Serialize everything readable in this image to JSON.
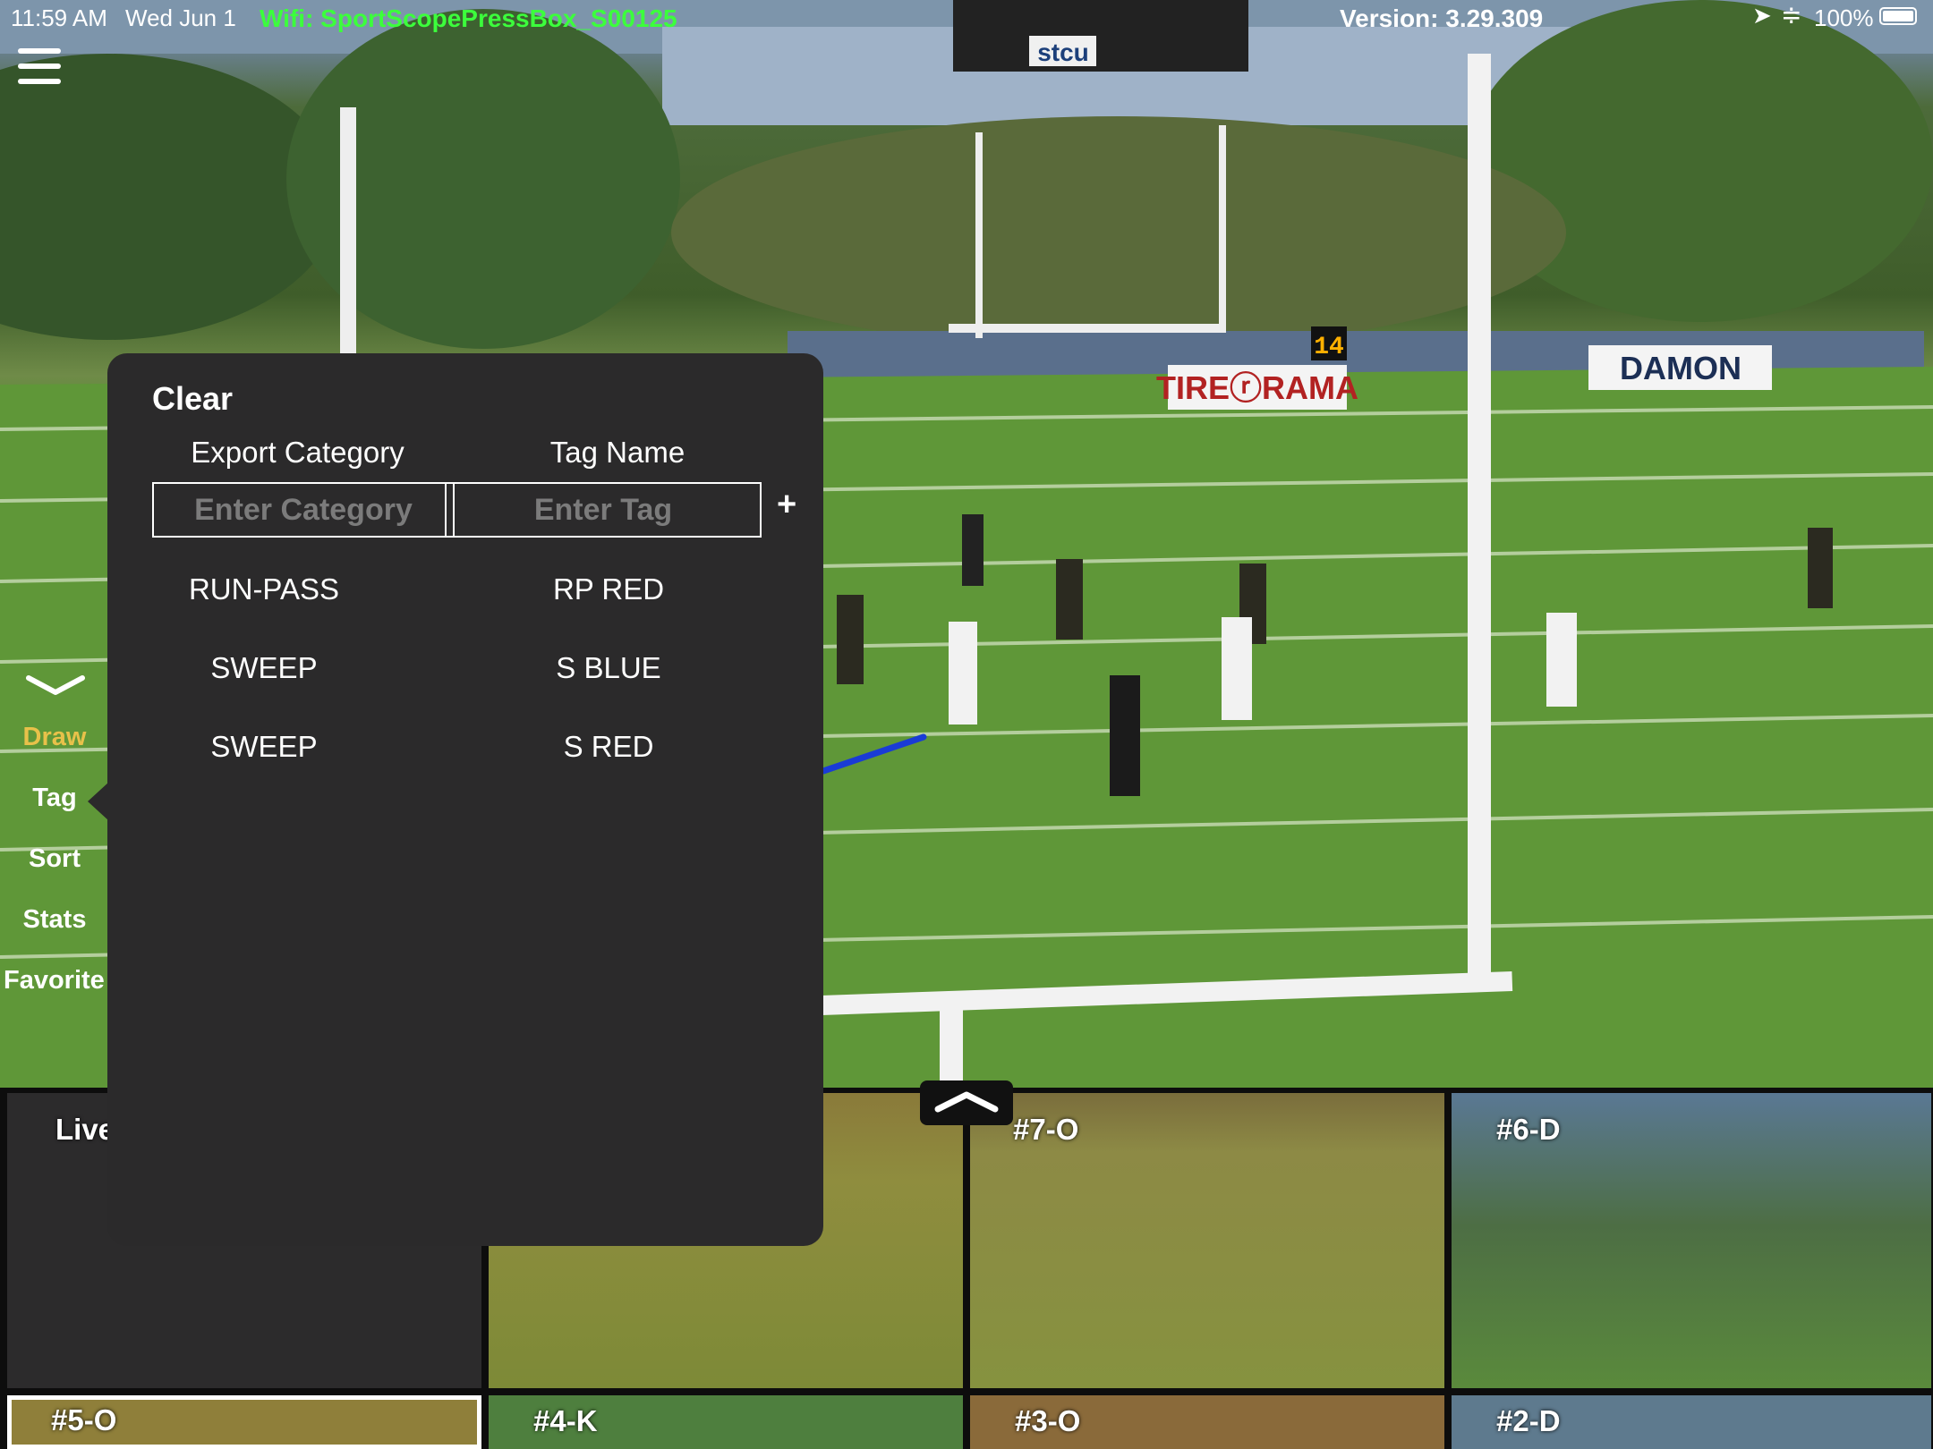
{
  "status": {
    "time": "11:59 AM",
    "date": "Wed Jun 1",
    "wifi": "Wifi: SportScopePressBox_S00125",
    "version": "Version: 3.29.309",
    "battery": "100%",
    "wifi_color": "#3cff3c"
  },
  "field_signs": {
    "sign1": "TIREⓡRAMA",
    "sign2": "ⒹDAMON",
    "scoreboard": "stcu",
    "play_clock": "14"
  },
  "sidebar": {
    "items": [
      {
        "label": "Draw"
      },
      {
        "label": "Tag"
      },
      {
        "label": "Sort"
      },
      {
        "label": "Stats"
      },
      {
        "label": "Favorite"
      }
    ],
    "active": "Draw",
    "active_color": "#e8c14a"
  },
  "popover": {
    "clear_label": "Clear",
    "col_category": "Export Category",
    "col_tag": "Tag Name",
    "category_placeholder": "Enter Category",
    "tag_placeholder": "Enter Tag",
    "add_label": "+",
    "rows": [
      {
        "category": "RUN-PASS",
        "tag": "RP RED"
      },
      {
        "category": "SWEEP",
        "tag": "S BLUE"
      },
      {
        "category": "SWEEP",
        "tag": "S RED"
      }
    ]
  },
  "thumbnails": [
    {
      "label": "Live"
    },
    {
      "label": "#7-O"
    },
    {
      "label": "#6-D"
    },
    {
      "label": "#5-O"
    },
    {
      "label": "#4-K"
    },
    {
      "label": "#3-O"
    },
    {
      "label": "#2-D"
    }
  ]
}
